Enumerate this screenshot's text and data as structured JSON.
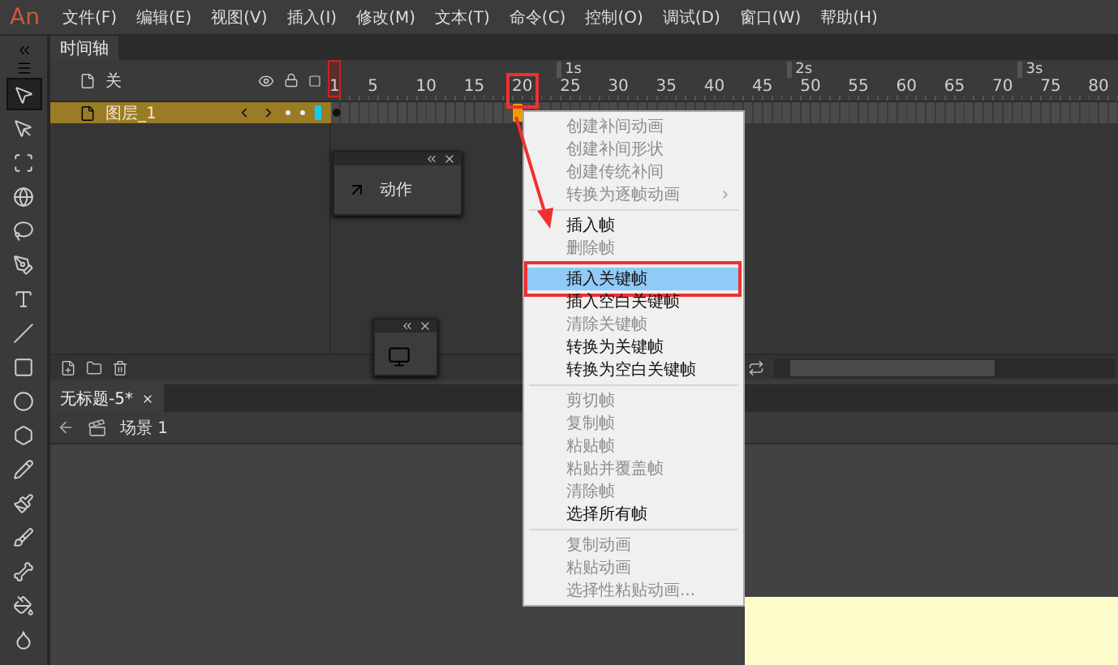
{
  "app": {
    "logo": "An"
  },
  "menu": [
    "文件(F)",
    "编辑(E)",
    "视图(V)",
    "插入(I)",
    "修改(M)",
    "文本(T)",
    "命令(C)",
    "控制(O)",
    "调试(D)",
    "窗口(W)",
    "帮助(H)"
  ],
  "tools": [
    {
      "kind": "selection",
      "selected": true
    },
    {
      "kind": "subselection",
      "selected": false
    },
    {
      "kind": "transform",
      "selected": false
    },
    {
      "kind": "rotate3d",
      "selected": false
    },
    {
      "kind": "lasso",
      "selected": false
    },
    {
      "kind": "pen",
      "selected": false
    },
    {
      "kind": "text",
      "selected": false
    },
    {
      "kind": "line",
      "selected": false
    },
    {
      "kind": "rectangle",
      "selected": false
    },
    {
      "kind": "oval",
      "selected": false
    },
    {
      "kind": "polystar",
      "selected": false
    },
    {
      "kind": "pencil",
      "selected": false
    },
    {
      "kind": "paintbrush",
      "selected": false
    },
    {
      "kind": "brush",
      "selected": false
    },
    {
      "kind": "bone",
      "selected": false
    },
    {
      "kind": "bucket",
      "selected": false
    },
    {
      "kind": "inkbottle",
      "selected": false
    }
  ],
  "timeline": {
    "tab": "时间轴",
    "header_label": "关",
    "seconds": [
      "1s",
      "2s",
      "3s"
    ],
    "frames": [
      "1",
      "5",
      "10",
      "15",
      "20",
      "25",
      "30",
      "35",
      "40",
      "45",
      "50",
      "55",
      "60",
      "65",
      "70",
      "75",
      "80"
    ],
    "layers": [
      {
        "name": "图层_1",
        "selected": true
      }
    ]
  },
  "actions_panel": {
    "label": "动作"
  },
  "document": {
    "tab": "无标题-5*",
    "scene": "场景 1"
  },
  "context_menu": {
    "groups": [
      [
        {
          "label": "创建补间动画",
          "disabled": true,
          "selected": false,
          "submenu": false
        },
        {
          "label": "创建补间形状",
          "disabled": true,
          "selected": false,
          "submenu": false
        },
        {
          "label": "创建传统补间",
          "disabled": true,
          "selected": false,
          "submenu": false
        },
        {
          "label": "转换为逐帧动画",
          "disabled": true,
          "selected": false,
          "submenu": true
        }
      ],
      [
        {
          "label": "插入帧",
          "disabled": false,
          "selected": false,
          "submenu": false
        },
        {
          "label": "删除帧",
          "disabled": true,
          "selected": false,
          "submenu": false
        }
      ],
      [
        {
          "label": "插入关键帧",
          "disabled": false,
          "selected": true,
          "submenu": false
        },
        {
          "label": "插入空白关键帧",
          "disabled": false,
          "selected": false,
          "submenu": false
        },
        {
          "label": "清除关键帧",
          "disabled": true,
          "selected": false,
          "submenu": false
        },
        {
          "label": "转换为关键帧",
          "disabled": false,
          "selected": false,
          "submenu": false
        },
        {
          "label": "转换为空白关键帧",
          "disabled": false,
          "selected": false,
          "submenu": false
        }
      ],
      [
        {
          "label": "剪切帧",
          "disabled": true,
          "selected": false,
          "submenu": false
        },
        {
          "label": "复制帧",
          "disabled": true,
          "selected": false,
          "submenu": false
        },
        {
          "label": "粘贴帧",
          "disabled": true,
          "selected": false,
          "submenu": false
        },
        {
          "label": "粘贴并覆盖帧",
          "disabled": true,
          "selected": false,
          "submenu": false
        },
        {
          "label": "清除帧",
          "disabled": true,
          "selected": false,
          "submenu": false
        },
        {
          "label": "选择所有帧",
          "disabled": false,
          "selected": false,
          "submenu": false
        }
      ],
      [
        {
          "label": "复制动画",
          "disabled": true,
          "selected": false,
          "submenu": false
        },
        {
          "label": "粘贴动画",
          "disabled": true,
          "selected": false,
          "submenu": false
        },
        {
          "label": "选择性粘贴动画...",
          "disabled": true,
          "selected": false,
          "submenu": false
        }
      ]
    ]
  }
}
